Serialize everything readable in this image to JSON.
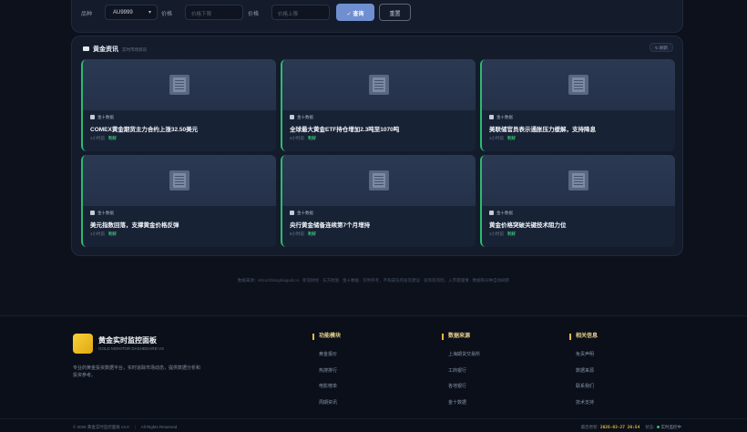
{
  "filters": {
    "variety_label": "品种",
    "variety_value": "AU9999",
    "min_price_label": "价格",
    "min_price_placeholder": "价格下限",
    "max_price_label": "价格",
    "max_price_placeholder": "价格上限",
    "query_label": "✓ 查询",
    "reset_label": "重置"
  },
  "news": {
    "title": "黄金资讯",
    "subtitle": "实时市场资讯",
    "refresh_label": "↻ 刷新",
    "cards": [
      {
        "source": "金十数据",
        "title": "COMEX黄金期货主力合约上涨32.50美元",
        "meta": "1小时前",
        "tag": "利好"
      },
      {
        "source": "金十数据",
        "title": "全球最大黄金ETF持仓增加2.3吨至1070吨",
        "meta": "4小时前",
        "tag": "利好"
      },
      {
        "source": "金十数据",
        "title": "美联储官员表示通胀压力缓解，支持降息",
        "meta": "1小时前",
        "tag": "利好"
      },
      {
        "source": "金十数据",
        "title": "美元指数回落，支撑黄金价格反弹",
        "meta": "1小时前",
        "tag": "利好"
      },
      {
        "source": "金十数据",
        "title": "央行黄金储备连续第7个月增持",
        "meta": "8小时前",
        "tag": "利好"
      },
      {
        "source": "金十数据",
        "title": "黄金价格突破关键技术阻力位",
        "meta": "1小时前",
        "tag": "利好"
      }
    ]
  },
  "disclaimer": "数据来源：Kitco/Shanghaigold.cn · 新浪财经 · 东方财富 · 金十数据 · 仅供参考，不构成任何投资建议 · 投资有风险，入市需谨慎 · 数据每分钟自动刷新",
  "footer": {
    "brand_title": "黄金实时监控面板",
    "brand_sub": "GOLD MONITOR DASHBOARD V3",
    "brand_desc": "专业的黄金投资数据平台，实时追踪市场动态，提供数据分析和投资参考。",
    "columns": [
      {
        "heading": "功能模块",
        "links": [
          "黄金报价",
          "热搜排行",
          "电影榜单",
          "周期资讯"
        ]
      },
      {
        "heading": "数据来源",
        "links": [
          "上海期货交易所",
          "工商银行",
          "各地银行",
          "金十数据"
        ]
      },
      {
        "heading": "相关信息",
        "links": [
          "免责声明",
          "数据来源",
          "联系我们",
          "技术支持"
        ]
      }
    ],
    "copyright": "© 2026 黄金实时监控面板 v3.0",
    "rights": "All Rights Reserved",
    "update_label": "最后更新:",
    "update_time": "2026-03-27 20:54",
    "status_label": "状态:",
    "status_value": "实时监控中"
  },
  "colors": {
    "accent_gold": "#e6b93b",
    "accent_green": "#2dba6f",
    "query_blue": "#6f8fd0"
  },
  "icons": {
    "news_header": "news-icon",
    "card_thumb": "document-icon",
    "source": "source-icon",
    "logo": "gold-logo"
  }
}
